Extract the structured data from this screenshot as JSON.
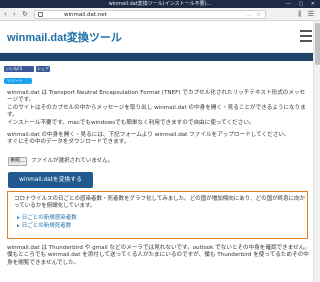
{
  "window": {
    "title": "winmail.dat変換ツール(インストール不要)...",
    "controls": "— ▢ ✕"
  },
  "browser": {
    "back_icon": "‹",
    "forward_icon": "›",
    "reload_icon": "↻",
    "url": "winmail.dat.net",
    "url_extras": "… ☆",
    "right_icons": "⫼ ☰"
  },
  "site": {
    "title": "winmail.dat変換ツール"
  },
  "share": {
    "facebook_label": "いいね!0",
    "share_label": "シェア",
    "twitter_label": "ツイート"
  },
  "intro": {
    "line1": "winmail.dat は Transport Neutral Encapsulation Format (TNEF) でカプセル化されたリッチテキスト形式のメッセージです。",
    "line2": "このサイトはそのカプセルの中からメッセージを取り出し winmail.dat の中身を開く・見ることができるようになります。",
    "line3": "インストール不要です。macでもwindowsでも簡単なく利用できますので自由に使ってください。"
  },
  "upload": {
    "line1": "winmail.dat の中身を開く・見るには、下記フォームより winmail.dat ファイルをアップロードしてください。",
    "line2": "すぐにその中のデータをダウンロードできます。",
    "file_button": "参照...",
    "file_status": "ファイルが選択されていません。",
    "convert_button": "winmail.datを変換する"
  },
  "notice": {
    "text": "コロナウイルスの日ごとの感染者数・死者数をグラフ化してみました。どの国が増加傾向にあり、どの国が終息に向かっているかを俯瞰化しています。",
    "links": [
      "日ごとの新規感染者数",
      "日ごとの新規死者数"
    ]
  },
  "footer_text": {
    "line1": "winmail.dat は Thunderbird や gmail などのメーラでは見れないです。outlook でないとその中身を確認できません。",
    "line2": "僕もところでも winmail.dat を添付して送ってくる人がたまにいるのですが、僕も Thunderbird を使ってるためその中身を閲覧できませんでした。"
  },
  "colors": {
    "title_blue": "#1e6fa8",
    "band_navy": "#22426c",
    "button_blue": "#205a8f",
    "notice_orange": "#e67e22",
    "facebook_blue": "#3b5998",
    "twitter_blue": "#1da1f2"
  }
}
